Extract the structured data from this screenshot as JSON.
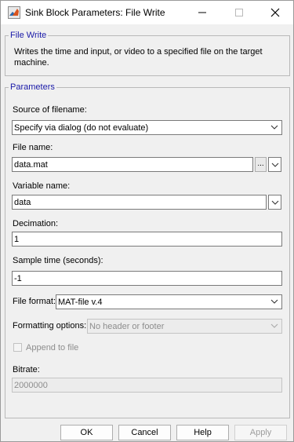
{
  "window": {
    "title": "Sink Block Parameters: File Write",
    "controls": [
      "minimize-icon",
      "maximize-icon",
      "close-icon"
    ]
  },
  "file_write_group": {
    "legend": "File Write",
    "description": "Writes the time and input, or video to a specified file on the target machine."
  },
  "parameters_group": {
    "legend": "Parameters",
    "source_of_filename": {
      "label": "Source of filename:",
      "value": "Specify via dialog (do not evaluate)"
    },
    "file_name": {
      "label": "File name:",
      "value": "data.mat",
      "browse_label": "..."
    },
    "variable_name": {
      "label": "Variable name:",
      "value": "data"
    },
    "decimation": {
      "label": "Decimation:",
      "value": "1"
    },
    "sample_time": {
      "label": "Sample time (seconds):",
      "value": "-1"
    },
    "file_format": {
      "label": "File format:",
      "value": "MAT-file v.4"
    },
    "formatting_options": {
      "label": "Formatting options:",
      "value": "No header or footer",
      "enabled": false
    },
    "append_to_file": {
      "label": "Append to file",
      "checked": false,
      "enabled": false
    },
    "bitrate": {
      "label": "Bitrate:",
      "value": "2000000",
      "enabled": false
    }
  },
  "buttons": {
    "ok": "OK",
    "cancel": "Cancel",
    "help": "Help",
    "apply": "Apply"
  },
  "colors": {
    "legend_text": "#1a1aa8",
    "disabled_text": "#8d8d8d",
    "window_bg": "#f0f0f0"
  }
}
